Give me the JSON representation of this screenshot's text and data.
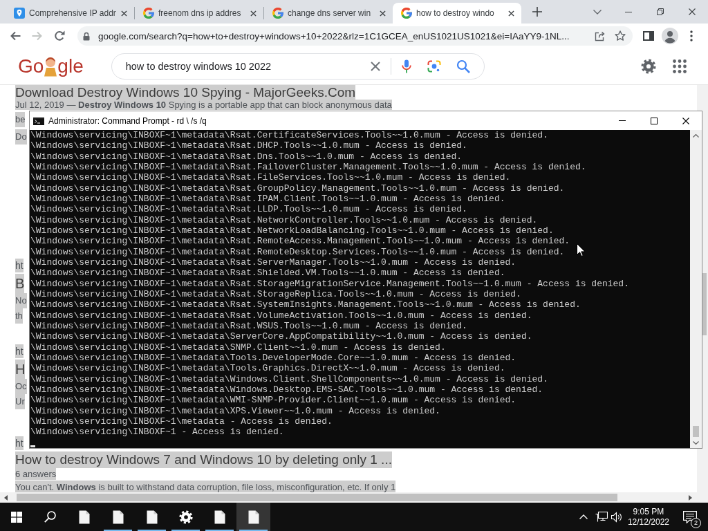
{
  "browser": {
    "tabs": [
      {
        "kind": "pin",
        "title": "Comprehensive IP addr",
        "selected": false
      },
      {
        "kind": "google",
        "title": "freenom dns ip addres",
        "selected": false
      },
      {
        "kind": "google",
        "title": "change dns server win",
        "selected": false
      },
      {
        "kind": "google",
        "title": "how to destroy windo",
        "selected": true
      }
    ],
    "nav": [
      {
        "kind": "back",
        "disabled": false
      },
      {
        "kind": "forward",
        "disabled": true
      },
      {
        "kind": "reload",
        "disabled": false
      }
    ],
    "address": "google.com/search?q=how+to+destroy+windows+10+2022&rlz=1C1GCEA_enUS1021US1021&ei=IAaYY9-1NL..."
  },
  "google": {
    "logo": {
      "left": "Go",
      "right": "gle"
    },
    "query": "how to destroy windows 10 2022"
  },
  "results": [
    {
      "title": "Download Destroy Windows 10 Spying - MajorGeeks.Com",
      "snippet": [
        "Jul 12, 2019 — **Destroy Windows 10** Spying is a portable app that can block anonymous data",
        "be",
        "Do"
      ]
    },
    {
      "url": "ht",
      "title": "B",
      "snippet": [
        "No",
        "th"
      ]
    },
    {
      "url": "ht",
      "title": "H",
      "snippet": [
        "Oc",
        "Ur"
      ]
    },
    {
      "url": "ht",
      "title": "How to destroy Windows 7 and Windows 10 by deleting only 1 ...",
      "meta": "6 answers",
      "snippet": [
        "You can't. **Windows** is built to withstand data corruption, file loss, misconfiguration, etc. If only 1"
      ]
    }
  ],
  "console": {
    "title": "Administrator: Command Prompt - rd \\ /s /q",
    "lines": [
      "\\Windows\\servicing\\INBOXF~1\\metadata\\Rsat.CertificateServices.Tools~~1.0.mum - Access is denied.",
      "\\Windows\\servicing\\INBOXF~1\\metadata\\Rsat.DHCP.Tools~~1.0.mum - Access is denied.",
      "\\Windows\\servicing\\INBOXF~1\\metadata\\Rsat.Dns.Tools~~1.0.mum - Access is denied.",
      "\\Windows\\servicing\\INBOXF~1\\metadata\\Rsat.FailoverCluster.Management.Tools~~1.0.mum - Access is denied.",
      "\\Windows\\servicing\\INBOXF~1\\metadata\\Rsat.FileServices.Tools~~1.0.mum - Access is denied.",
      "\\Windows\\servicing\\INBOXF~1\\metadata\\Rsat.GroupPolicy.Management.Tools~~1.0.mum - Access is denied.",
      "\\Windows\\servicing\\INBOXF~1\\metadata\\Rsat.IPAM.Client.Tools~~1.0.mum - Access is denied.",
      "\\Windows\\servicing\\INBOXF~1\\metadata\\Rsat.LLDP.Tools~~1.0.mum - Access is denied.",
      "\\Windows\\servicing\\INBOXF~1\\metadata\\Rsat.NetworkController.Tools~~1.0.mum - Access is denied.",
      "\\Windows\\servicing\\INBOXF~1\\metadata\\Rsat.NetworkLoadBalancing.Tools~~1.0.mum - Access is denied.",
      "\\Windows\\servicing\\INBOXF~1\\metadata\\Rsat.RemoteAccess.Management.Tools~~1.0.mum - Access is denied.",
      "\\Windows\\servicing\\INBOXF~1\\metadata\\Rsat.RemoteDesktop.Services.Tools~~1.0.mum - Access is denied.",
      "\\Windows\\servicing\\INBOXF~1\\metadata\\Rsat.ServerManager.Tools~~1.0.mum - Access is denied.",
      "\\Windows\\servicing\\INBOXF~1\\metadata\\Rsat.Shielded.VM.Tools~~1.0.mum - Access is denied.",
      "\\Windows\\servicing\\INBOXF~1\\metadata\\Rsat.StorageMigrationService.Management.Tools~~1.0.mum - Access is denied.",
      "\\Windows\\servicing\\INBOXF~1\\metadata\\Rsat.StorageReplica.Tools~~1.0.mum - Access is denied.",
      "\\Windows\\servicing\\INBOXF~1\\metadata\\Rsat.SystemInsights.Management.Tools~~1.0.mum - Access is denied.",
      "\\Windows\\servicing\\INBOXF~1\\metadata\\Rsat.VolumeActivation.Tools~~1.0.mum - Access is denied.",
      "\\Windows\\servicing\\INBOXF~1\\metadata\\Rsat.WSUS.Tools~~1.0.mum - Access is denied.",
      "\\Windows\\servicing\\INBOXF~1\\metadata\\ServerCore.AppCompatibility~~1.0.mum - Access is denied.",
      "\\Windows\\servicing\\INBOXF~1\\metadata\\SNMP.Client~~1.0.mum - Access is denied.",
      "\\Windows\\servicing\\INBOXF~1\\metadata\\Tools.DeveloperMode.Core~~1.0.mum - Access is denied.",
      "\\Windows\\servicing\\INBOXF~1\\metadata\\Tools.Graphics.DirectX~~1.0.mum - Access is denied.",
      "\\Windows\\servicing\\INBOXF~1\\metadata\\Windows.Client.ShellComponents~~1.0.mum - Access is denied.",
      "\\Windows\\servicing\\INBOXF~1\\metadata\\Windows.Desktop.EMS-SAC.Tools~~1.0.mum - Access is denied.",
      "\\Windows\\servicing\\INBOXF~1\\metadata\\WMI-SNMP-Provider.Client~~1.0.mum - Access is denied.",
      "\\Windows\\servicing\\INBOXF~1\\metadata\\XPS.Viewer~~1.0.mum - Access is denied.",
      "\\Windows\\servicing\\INBOXF~1\\metadata - Access is denied.",
      "\\Windows\\servicing\\INBOXF~1 - Access is denied."
    ]
  },
  "taskbar": {
    "apps": [
      {
        "kind": "file",
        "running": false,
        "selected": false
      },
      {
        "kind": "file",
        "running": true,
        "selected": false
      },
      {
        "kind": "file",
        "running": true,
        "selected": false
      },
      {
        "kind": "gear",
        "running": true,
        "selected": false
      },
      {
        "kind": "file",
        "running": true,
        "selected": false
      },
      {
        "kind": "file",
        "running": true,
        "selected": true
      }
    ],
    "time": "9:05 PM",
    "date": "12/12/2022",
    "notifications": "2"
  }
}
